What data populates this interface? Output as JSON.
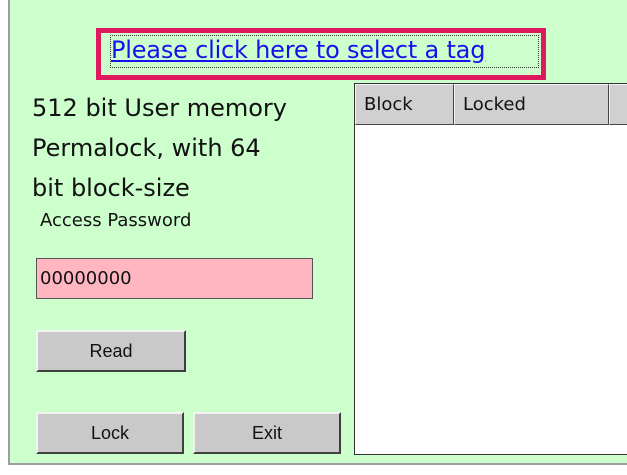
{
  "header": {
    "select_tag_link": "Please click here to select a tag"
  },
  "info": {
    "description": "512 bit User memory\nPermalock, with 64\nbit block-size"
  },
  "form": {
    "access_password_label": "Access Password",
    "access_password_value": "00000000"
  },
  "buttons": {
    "read": "Read",
    "lock": "Lock",
    "exit": "Exit"
  },
  "table": {
    "columns": [
      "Block",
      "Locked",
      ""
    ],
    "rows": []
  },
  "colors": {
    "background": "#ccffcc",
    "password_field": "#ffb6c1",
    "highlight_border": "#e0195f",
    "link": "#1a10ee"
  }
}
